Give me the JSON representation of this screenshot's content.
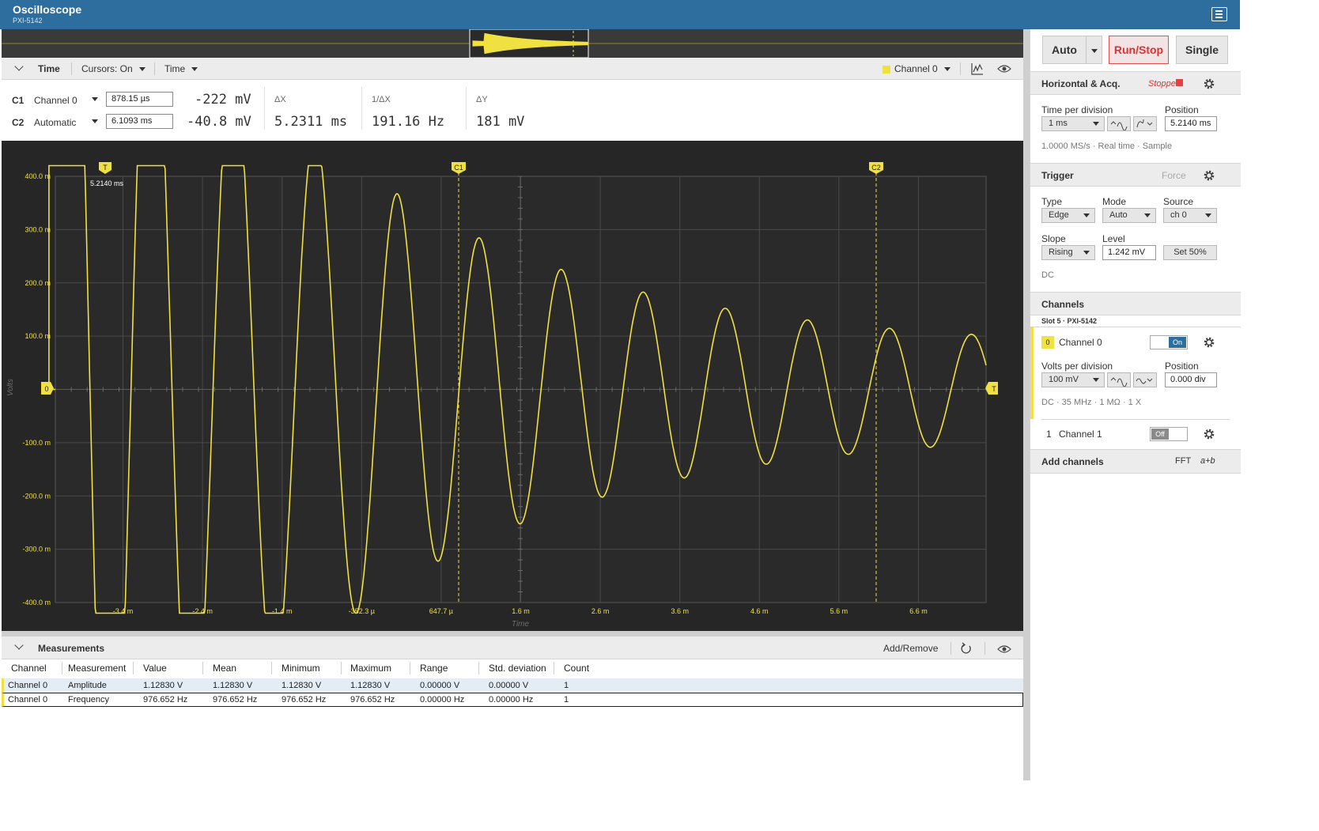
{
  "app": {
    "title": "Oscilloscope",
    "device": "PXI-5142"
  },
  "time_header": {
    "section": "Time",
    "cursors": "Cursors: On",
    "mode": "Time",
    "channel": "Channel 0",
    "channel_color": "#f0e040"
  },
  "cursors": {
    "c1": {
      "label": "C1",
      "source": "Channel 0",
      "position": "878.15 µs",
      "value": "-222 mV"
    },
    "c2": {
      "label": "C2",
      "source": "Automatic",
      "position": "6.1093 ms",
      "value": "-40.8 mV"
    },
    "dx": {
      "label": "ΔX",
      "value": "5.2311 ms"
    },
    "inv_dx": {
      "label": "1/ΔX",
      "value": "191.16 Hz"
    },
    "dy": {
      "label": "ΔY",
      "value": "181 mV"
    }
  },
  "plot": {
    "trigger_marker": "T",
    "trigger_time_label": "5.2140 ms",
    "c1_marker": "C1",
    "c2_marker": "C2",
    "channel_marker": "0",
    "right_marker": "T",
    "y_axis_title": "Volts",
    "x_axis_title": "Time",
    "y_ticks": [
      "400.0 m",
      "300.0 m",
      "200.0 m",
      "100.0 m",
      "0",
      "-100.0 m",
      "-200.0 m",
      "-300.0 m",
      "-400.0 m"
    ],
    "x_ticks": [
      "-3.4 m",
      "-2.4 m",
      "-1.4 m",
      "-352.3 µ",
      "647.7 µ",
      "1.6 m",
      "2.6 m",
      "3.6 m",
      "4.6 m",
      "5.6 m",
      "6.6 m"
    ],
    "trace_color": "#f0e040"
  },
  "measurements": {
    "title": "Measurements",
    "add_remove": "Add/Remove",
    "columns": [
      "Channel",
      "Measurement",
      "Value",
      "Mean",
      "Minimum",
      "Maximum",
      "Range",
      "Std. deviation",
      "Count"
    ],
    "rows": [
      [
        "Channel 0",
        "Amplitude",
        "1.12830 V",
        "1.12830 V",
        "1.12830 V",
        "1.12830 V",
        "0.00000 V",
        "0.00000 V",
        "1"
      ],
      [
        "Channel 0",
        "Frequency",
        "976.652 Hz",
        "976.652 Hz",
        "976.652 Hz",
        "976.652 Hz",
        "0.00000 Hz",
        "0.00000 Hz",
        "1"
      ]
    ]
  },
  "controls": {
    "auto": "Auto",
    "run_stop": "Run/Stop",
    "single": "Single",
    "horizontal": {
      "title": "Horizontal & Acq.",
      "status": "Stopped",
      "time_per_division_label": "Time per division",
      "time_per_division": "1 ms",
      "position_label": "Position",
      "position": "5.2140 ms",
      "info": "1.0000 MS/s  ·  Real time  ·  Sample"
    },
    "trigger": {
      "title": "Trigger",
      "force": "Force",
      "type_label": "Type",
      "type": "Edge",
      "mode_label": "Mode",
      "mode": "Auto",
      "source_label": "Source",
      "source": "ch 0",
      "slope_label": "Slope",
      "slope": "Rising",
      "level_label": "Level",
      "level": "1.242 mV",
      "set50": "Set 50%",
      "coupling": "DC"
    },
    "channels": {
      "title": "Channels",
      "slot": "Slot 5  ·  PXI-5142",
      "ch0": {
        "index": "0",
        "name": "Channel 0",
        "state": "On",
        "volts_label": "Volts per division",
        "volts": "100 mV",
        "position_label": "Position",
        "position": "0.000 div",
        "info": "DC  ·  35 MHz  ·  1 MΩ  ·  1 X"
      },
      "ch1": {
        "index": "1",
        "name": "Channel 1",
        "state": "Off"
      },
      "add": "Add channels",
      "fft": "FFT",
      "math": "a+b"
    }
  }
}
